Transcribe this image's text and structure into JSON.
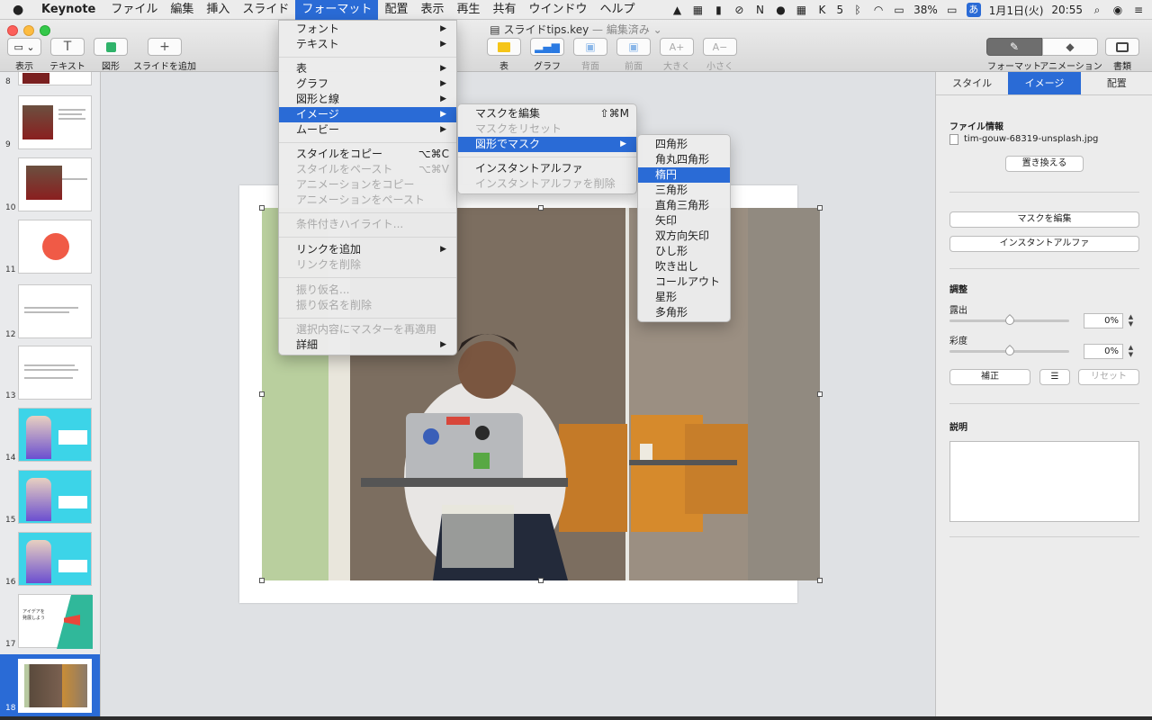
{
  "menubar": {
    "app": "Keynote",
    "items": [
      "ファイル",
      "編集",
      "挿入",
      "スライド",
      "フォーマット",
      "配置",
      "表示",
      "再生",
      "共有",
      "ウインドウ",
      "ヘルプ"
    ],
    "battery": "38%",
    "ime": "あ",
    "date": "1月1日(火)",
    "time": "20:55",
    "badge_num": "5"
  },
  "window": {
    "title": "スライドtips.key",
    "title_suffix": "— 編集済み ⌄"
  },
  "toolbar": {
    "view": "表示",
    "text": "テキスト",
    "shape": "図形",
    "add_slide": "スライドを追加",
    "table": "表",
    "chart": "グラフ",
    "back": "背面",
    "front": "前面",
    "bigger": "大きく",
    "smaller": "小さく",
    "bigger_glyph": "A+",
    "smaller_glyph": "A−",
    "format": "フォーマット",
    "animate": "アニメーション",
    "document": "書類"
  },
  "navigator": {
    "slide_numbers": [
      "8",
      "9",
      "10",
      "11",
      "12",
      "13",
      "14",
      "15",
      "16",
      "17",
      "18"
    ],
    "slide17_text": "アイデアを\n発展しよう"
  },
  "inspector": {
    "tabs": [
      "スタイル",
      "イメージ",
      "配置"
    ],
    "file_info_title": "ファイル情報",
    "file_name": "tim-gouw-68319-unsplash.jpg",
    "replace_label": "置き換える",
    "edit_mask_label": "マスクを編集",
    "instant_alpha_label": "インスタントアルファ",
    "adjust_title": "調整",
    "exposure_label": "露出",
    "exposure_value": "0%",
    "saturation_label": "彩度",
    "saturation_value": "0%",
    "enhance_label": "補正",
    "reset_label": "リセット",
    "description_title": "説明"
  },
  "format_menu": {
    "items": [
      {
        "label": "フォント",
        "arrow": "▶"
      },
      {
        "label": "テキスト",
        "arrow": "▶"
      },
      {
        "label": "表",
        "arrow": "▶"
      },
      {
        "label": "グラフ",
        "arrow": "▶"
      },
      {
        "label": "図形と線",
        "arrow": "▶"
      },
      {
        "label": "イメージ",
        "arrow": "▶"
      },
      {
        "label": "ムービー",
        "arrow": "▶"
      },
      {
        "label": "スタイルをコピー",
        "shortcut": "⌥⌘C"
      },
      {
        "label": "スタイルをペースト",
        "shortcut": "⌥⌘V"
      },
      {
        "label": "アニメーションをコピー"
      },
      {
        "label": "アニメーションをペースト"
      },
      {
        "label": "条件付きハイライト..."
      },
      {
        "label": "リンクを追加",
        "arrow": "▶"
      },
      {
        "label": "リンクを削除"
      },
      {
        "label": "振り仮名..."
      },
      {
        "label": "振り仮名を削除"
      },
      {
        "label": "選択内容にマスターを再適用"
      },
      {
        "label": "詳細",
        "arrow": "▶"
      }
    ]
  },
  "image_menu": {
    "items": [
      {
        "label": "マスクを編集",
        "shortcut": "⇧⌘M"
      },
      {
        "label": "マスクをリセット"
      },
      {
        "label": "図形でマスク",
        "arrow": "▶"
      },
      {
        "label": "インスタントアルファ"
      },
      {
        "label": "インスタントアルファを削除"
      }
    ]
  },
  "shape_menu": {
    "items": [
      "四角形",
      "角丸四角形",
      "楕円",
      "三角形",
      "直角三角形",
      "矢印",
      "双方向矢印",
      "ひし形",
      "吹き出し",
      "コールアウト",
      "星形",
      "多角形"
    ]
  },
  "colors": {
    "accent": "#2a6bd6",
    "menu_bg": "#ececec",
    "canvas_bg": "#dfe1e4"
  }
}
